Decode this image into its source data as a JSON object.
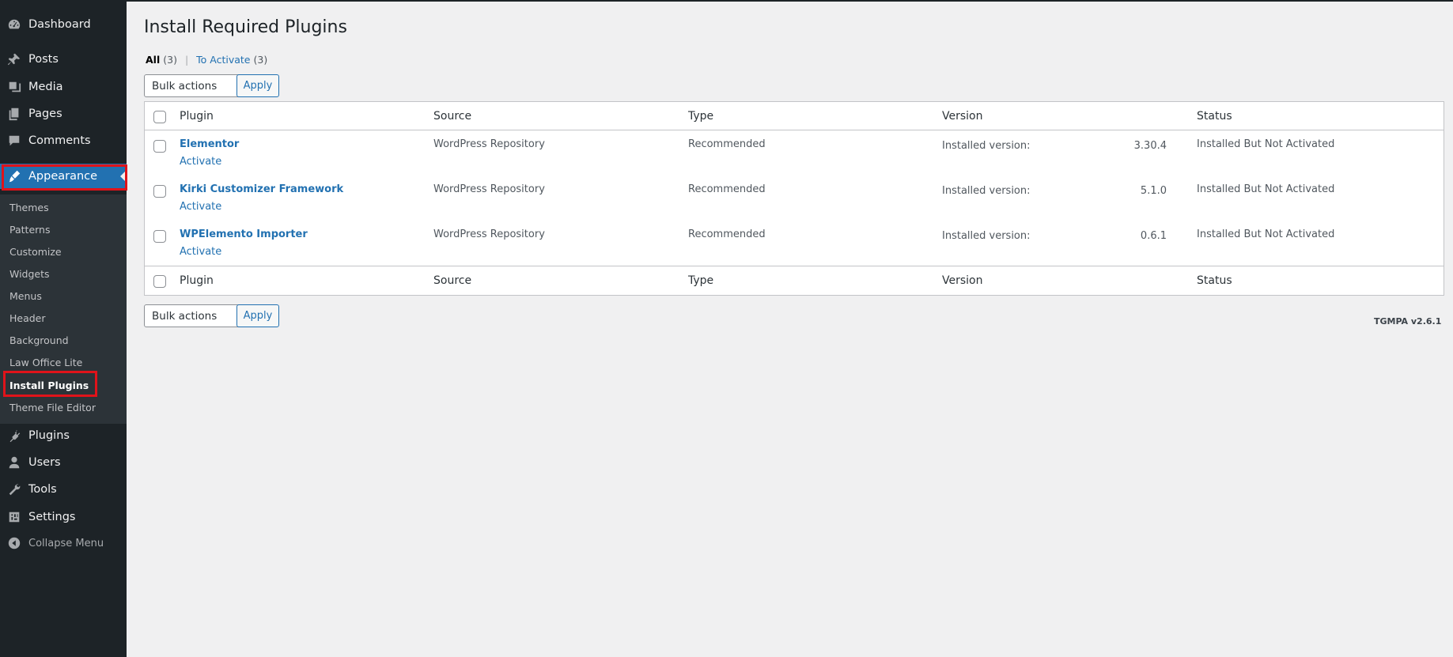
{
  "sidebar": {
    "dashboard": "Dashboard",
    "posts": "Posts",
    "media": "Media",
    "pages": "Pages",
    "comments": "Comments",
    "appearance": "Appearance",
    "submenu": [
      "Themes",
      "Patterns",
      "Customize",
      "Widgets",
      "Menus",
      "Header",
      "Background",
      "Law Office Lite",
      "Install Plugins",
      "Theme File Editor"
    ],
    "plugins": "Plugins",
    "users": "Users",
    "tools": "Tools",
    "settings": "Settings",
    "collapse": "Collapse Menu"
  },
  "page": {
    "title": "Install Required Plugins",
    "filters": {
      "all_label": "All",
      "all_count": "(3)",
      "separator": "|",
      "to_activate_label": "To Activate",
      "to_activate_count": "(3)"
    },
    "bulk_actions": "Bulk actions",
    "apply": "Apply"
  },
  "table": {
    "headers": [
      "Plugin",
      "Source",
      "Type",
      "Version",
      "Status"
    ],
    "rows": [
      {
        "name": "Elementor",
        "action": "Activate",
        "source": "WordPress Repository",
        "type": "Recommended",
        "version_label": "Installed version:",
        "version": "3.30.4",
        "status": "Installed But Not Activated"
      },
      {
        "name": "Kirki Customizer Framework",
        "action": "Activate",
        "source": "WordPress Repository",
        "type": "Recommended",
        "version_label": "Installed version:",
        "version": "5.1.0",
        "status": "Installed But Not Activated"
      },
      {
        "name": "WPElemento Importer",
        "action": "Activate",
        "source": "WordPress Repository",
        "type": "Recommended",
        "version_label": "Installed version:",
        "version": "0.6.1",
        "status": "Installed But Not Activated"
      }
    ]
  },
  "footer": {
    "tgmpa": "TGMPA v2.6.1"
  },
  "colors": {
    "sidebar_bg": "#1d2327",
    "accent": "#2271b1",
    "highlight": "#e0131a"
  }
}
